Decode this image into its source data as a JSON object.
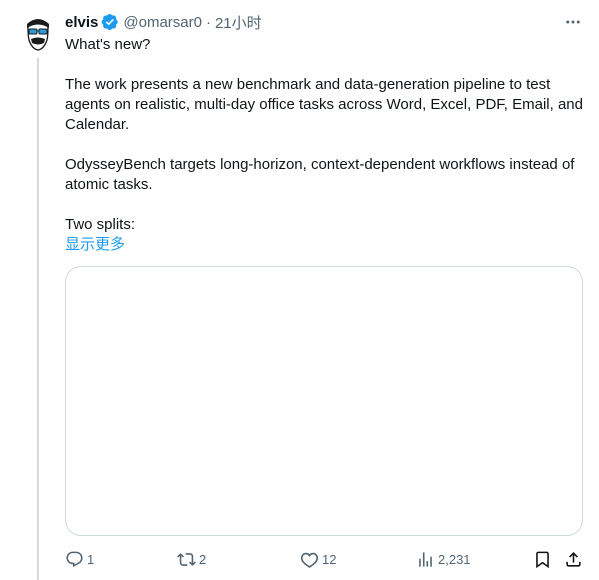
{
  "tweet": {
    "author_name": "elvis",
    "author_handle": "@omarsar0",
    "separator": "·",
    "timestamp": "21小时",
    "text_lines": [
      "What's new?",
      "The work presents a new benchmark and data-generation pipeline to test agents on realistic, multi-day office tasks across Word, Excel, PDF, Email, and Calendar.",
      "OdysseyBench targets long-horizon, context-dependent workflows instead of atomic tasks.",
      "Two splits:"
    ],
    "show_more_label": "显示更多"
  },
  "actions": {
    "replies": "1",
    "retweets": "2",
    "likes": "12",
    "views": "2,231"
  },
  "colors": {
    "accent": "#1d9bf0",
    "text": "#0f1419",
    "secondary": "#536471",
    "border": "#cfd9de"
  },
  "icons": {
    "verified": "verified-badge-icon",
    "more": "more-horizontal-icon",
    "reply": "reply-icon",
    "retweet": "retweet-icon",
    "like": "heart-icon",
    "views": "views-chart-icon",
    "bookmark": "bookmark-icon",
    "share": "share-icon"
  }
}
